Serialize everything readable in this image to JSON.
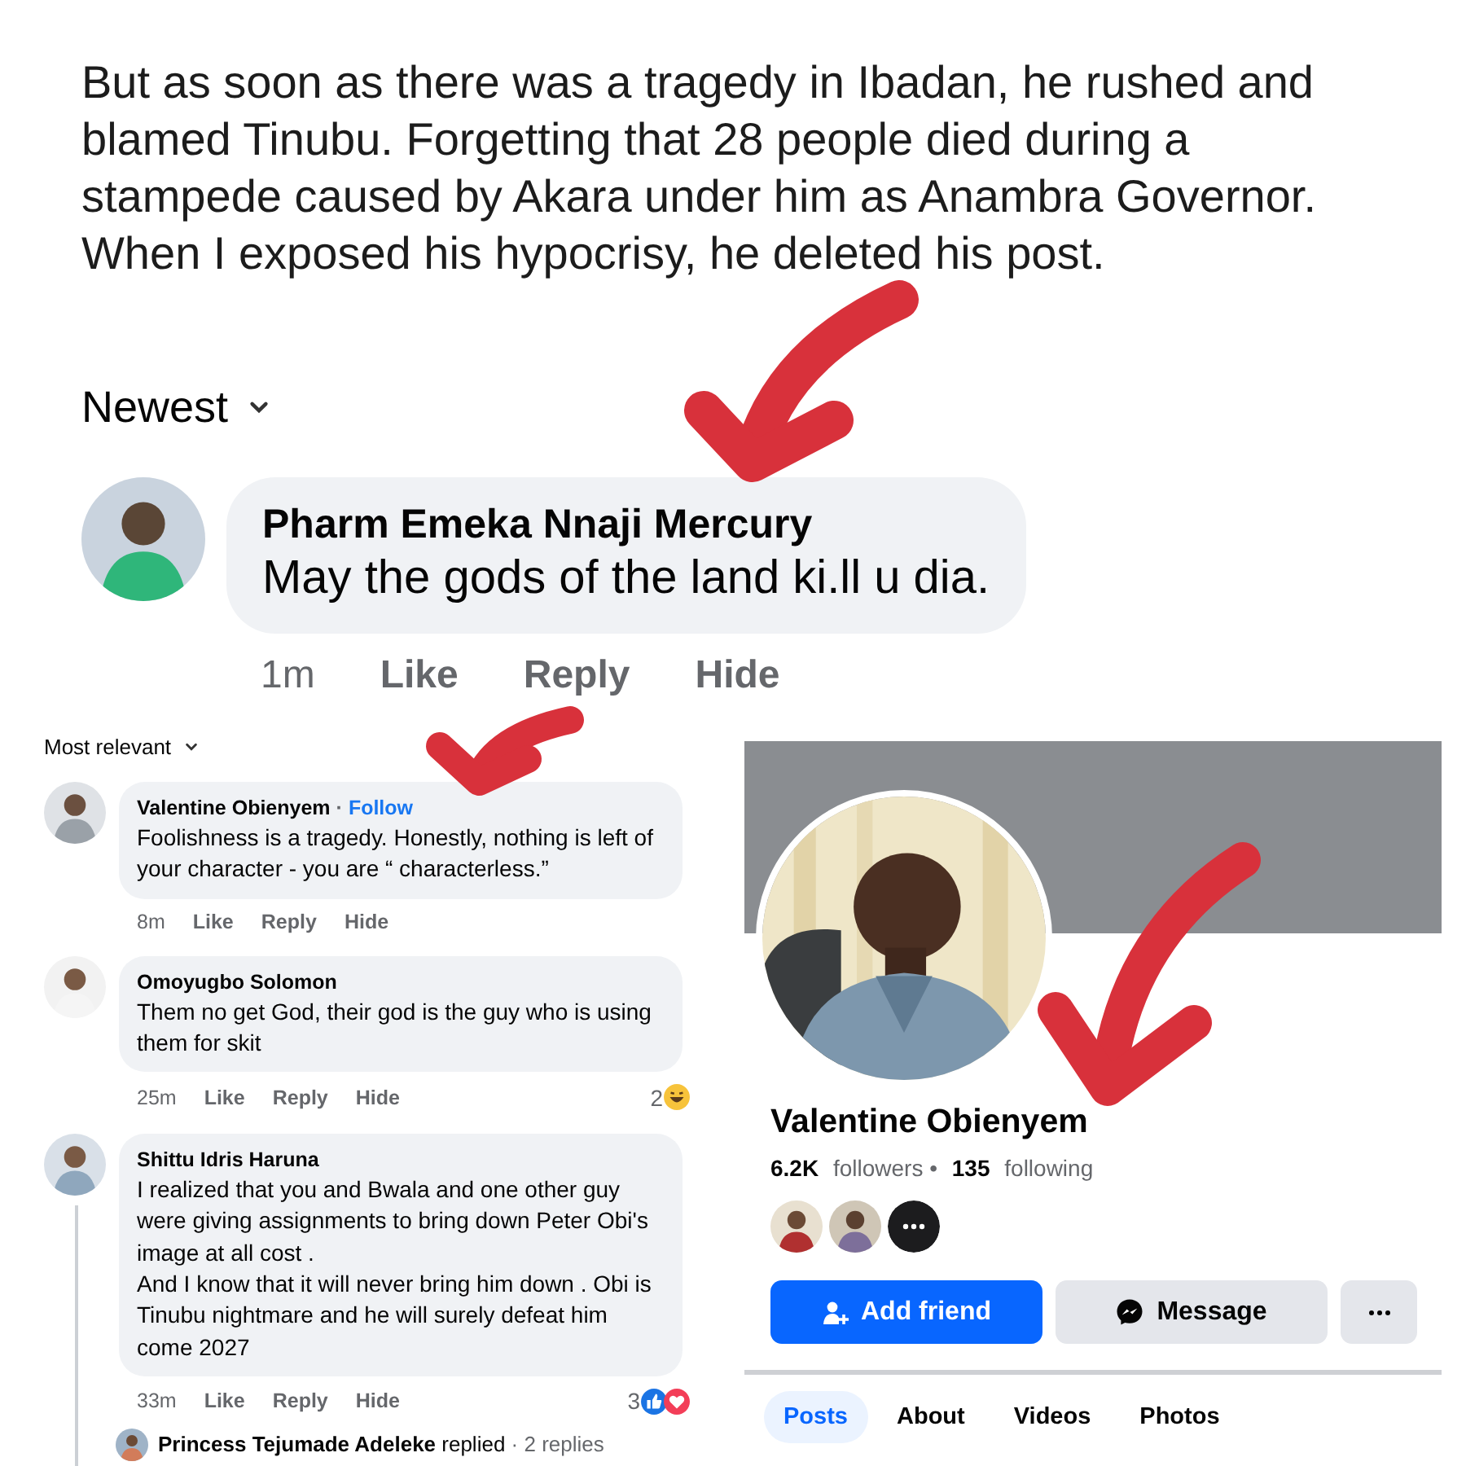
{
  "post": {
    "paragraphs": [
      "But as soon as there was a tragedy in Ibadan, he rushed and blamed Tinubu. Forgetting that 28 people died during a stampede caused by Akara under him as Anambra Governor. When I exposed his hypocrisy, he deleted his post."
    ]
  },
  "comments_top": {
    "sort": "Newest",
    "comments": [
      {
        "author": "Pharm Emeka Nnaji Mercury",
        "text": "May the gods of the land ki.ll u dia.",
        "time": "1m",
        "actions": [
          "Like",
          "Reply",
          "Hide"
        ]
      }
    ]
  },
  "comments_bottom": {
    "sort": "Most relevant",
    "comments": [
      {
        "author": "Valentine Obienyem",
        "separator": "·",
        "follow": "Follow",
        "text": "Foolishness is a tragedy. Honestly, nothing is left of your character - you are “ characterless.”",
        "time": "8m",
        "actions": [
          "Like",
          "Reply",
          "Hide"
        ]
      },
      {
        "author": "Omoyugbo Solomon",
        "text": "Them no get God, their god is the guy who is using them for skit",
        "time": "25m",
        "actions": [
          "Like",
          "Reply",
          "Hide"
        ],
        "reaction_count": "2",
        "reactions": [
          {
            "kind": "haha"
          }
        ]
      },
      {
        "author": "Shittu Idris Haruna",
        "text": "I realized that you and Bwala and one other guy were giving assignments to bring down Peter Obi's image at all cost .\nAnd I know that it will never bring him down . Obi is Tinubu nightmare and he will surely defeat him come 2027",
        "time": "33m",
        "actions": [
          "Like",
          "Reply",
          "Hide"
        ],
        "reaction_count": "3",
        "reactions": [
          {
            "kind": "like"
          },
          {
            "kind": "love"
          }
        ],
        "replies": {
          "author": "Princess Tejumade Adeleke",
          "verb": "replied",
          "separator": "·",
          "count": "2 replies"
        }
      }
    ]
  },
  "profile": {
    "name": "Valentine Obienyem",
    "followers_count": "6.2K",
    "followers_label": "followers",
    "separator": "•",
    "following_count": "135",
    "following_label": "following",
    "friends": [
      {
        "kind": "avatar"
      },
      {
        "kind": "avatar"
      },
      {
        "kind": "more"
      }
    ],
    "buttons": [
      {
        "kind": "primary",
        "label": "Add friend"
      },
      {
        "kind": "secondary",
        "label": "Message"
      },
      {
        "kind": "more"
      }
    ],
    "tabs": [
      {
        "label": "Posts",
        "selected": true
      },
      {
        "label": "About",
        "selected": false
      },
      {
        "label": "Videos",
        "selected": false
      },
      {
        "label": "Photos",
        "selected": false
      }
    ]
  }
}
